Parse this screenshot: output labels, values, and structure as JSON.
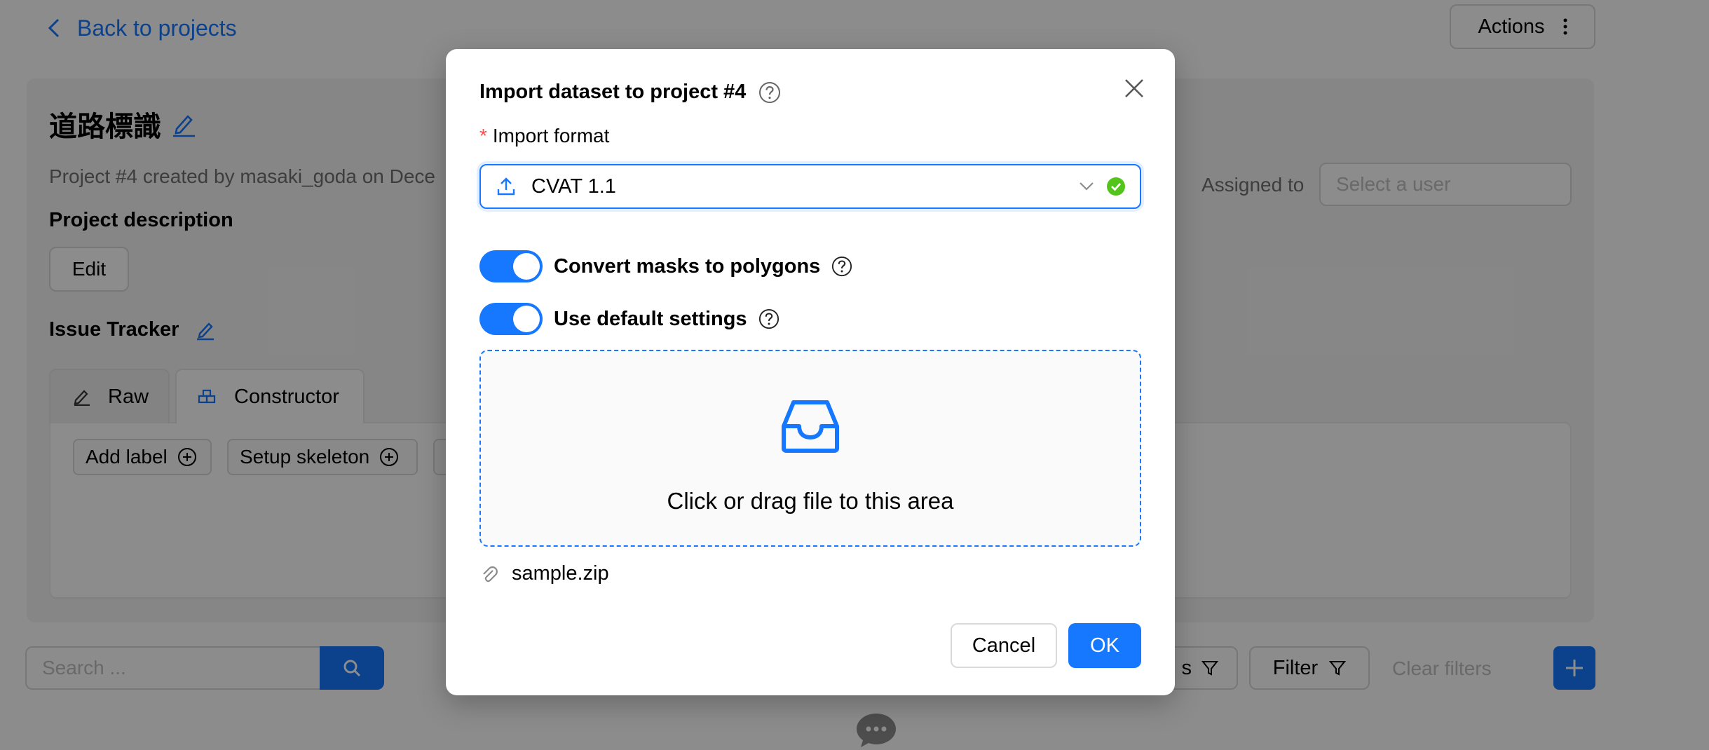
{
  "page": {
    "back_link": "Back to projects",
    "actions_label": "Actions",
    "project_title": "道路標識",
    "project_meta": "Project #4 created by masaki_goda on Dece",
    "assigned_label": "Assigned to",
    "assigned_placeholder": "Select a user",
    "description_title": "Project description",
    "edit_label": "Edit",
    "issue_tracker_label": "Issue Tracker",
    "tabs": [
      {
        "label": "Raw",
        "icon": "pencil-icon"
      },
      {
        "label": "Constructor",
        "icon": "constructor-icon"
      }
    ],
    "add_label": "Add label",
    "setup_skeleton": "Setup skeleton",
    "search_placeholder": "Search ...",
    "sort_partial": "s",
    "filter_label": "Filter",
    "clear_filters": "Clear filters"
  },
  "modal": {
    "title": "Import dataset to project #4",
    "format_label": "Import format",
    "format_value": "CVAT 1.1",
    "convert_masks_label": "Convert masks to polygons",
    "convert_masks_on": true,
    "default_settings_label": "Use default settings",
    "default_settings_on": true,
    "dropzone_text": "Click or drag file to this area",
    "file_name": "sample.zip",
    "cancel_label": "Cancel",
    "ok_label": "OK"
  },
  "colors": {
    "primary": "#1677ff",
    "success": "#52c41a",
    "required": "#ff4d4f"
  }
}
